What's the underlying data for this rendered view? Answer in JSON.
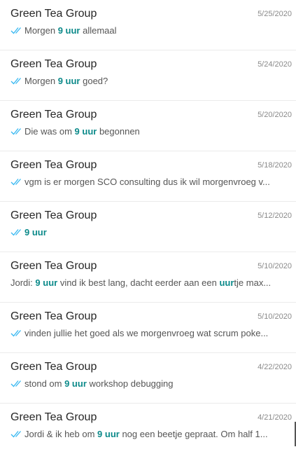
{
  "colors": {
    "tick": "#34b7f1",
    "highlight": "#0c8a8a",
    "text": "#262626",
    "muted": "#8a8a8a"
  },
  "conversations": [
    {
      "title": "Green Tea Group",
      "date": "5/25/2020",
      "tick": true,
      "preview": [
        {
          "t": "Morgen "
        },
        {
          "t": "9 uur",
          "hl": true
        },
        {
          "t": " allemaal"
        }
      ]
    },
    {
      "title": "Green Tea Group",
      "date": "5/24/2020",
      "tick": true,
      "preview": [
        {
          "t": "Morgen "
        },
        {
          "t": "9 uur",
          "hl": true
        },
        {
          "t": " goed?"
        }
      ]
    },
    {
      "title": "Green Tea Group",
      "date": "5/20/2020",
      "tick": true,
      "preview": [
        {
          "t": "Die was om "
        },
        {
          "t": "9 uur",
          "hl": true
        },
        {
          "t": " begonnen"
        }
      ]
    },
    {
      "title": "Green Tea Group",
      "date": "5/18/2020",
      "tick": true,
      "preview": [
        {
          "t": "vgm is er morgen SCO consulting dus ik wil morgenvroeg v..."
        }
      ]
    },
    {
      "title": "Green Tea Group",
      "date": "5/12/2020",
      "tick": true,
      "preview": [
        {
          "t": "9 uur",
          "hl": true
        }
      ]
    },
    {
      "title": "Green Tea Group",
      "date": "5/10/2020",
      "tick": false,
      "preview": [
        {
          "t": "Jordi: "
        },
        {
          "t": "9 uur",
          "hl": true
        },
        {
          "t": " vind ik best lang, dacht eerder aan een "
        },
        {
          "t": "uur",
          "hl": true
        },
        {
          "t": "tje max..."
        }
      ]
    },
    {
      "title": "Green Tea Group",
      "date": "5/10/2020",
      "tick": true,
      "preview": [
        {
          "t": "vinden jullie het goed als we morgenvroeg wat scrum poke..."
        }
      ]
    },
    {
      "title": "Green Tea Group",
      "date": "4/22/2020",
      "tick": true,
      "preview": [
        {
          "t": "stond om "
        },
        {
          "t": "9 uur",
          "hl": true
        },
        {
          "t": " workshop debugging"
        }
      ]
    },
    {
      "title": "Green Tea Group",
      "date": "4/21/2020",
      "tick": true,
      "preview": [
        {
          "t": "Jordi & ik heb om "
        },
        {
          "t": "9 uur",
          "hl": true
        },
        {
          "t": " nog een beetje gepraat. Om half 1..."
        }
      ]
    }
  ]
}
